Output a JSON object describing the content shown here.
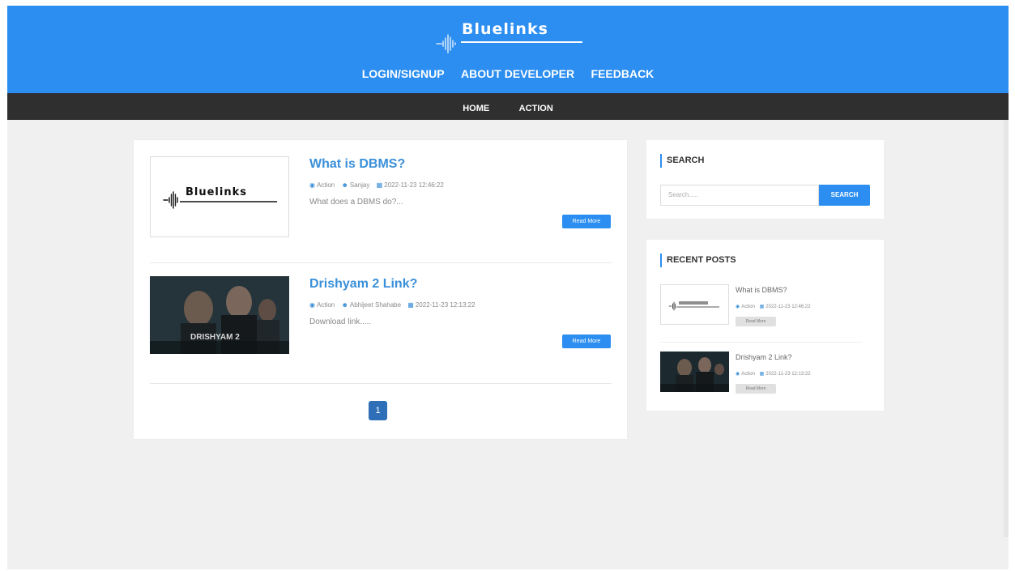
{
  "brand": {
    "name": "Bluelinks",
    "color": "#2b8ef0"
  },
  "top_nav": [
    "LOGIN/SIGNUP",
    "ABOUT DEVELOPER",
    "FEEDBACK"
  ],
  "sub_nav": [
    "HOME",
    "ACTION"
  ],
  "posts": [
    {
      "title": "What is DBMS?",
      "category": "Action",
      "author": "Sanjay",
      "date": "2022-11-23 12:46:22",
      "excerpt": "What does a DBMS do?...",
      "read_more": "Read More",
      "thumb_logo_text": "Bluelinks"
    },
    {
      "title": "Drishyam 2 Link?",
      "category": "Action",
      "author": "Abhijeet Shahabe",
      "date": "2022-11-23 12:13:22",
      "excerpt": "Download link.....",
      "read_more": "Read More",
      "thumb_poster_text": "DRISHYAM 2"
    }
  ],
  "pagination": {
    "current": "1"
  },
  "search_widget": {
    "title": "SEARCH",
    "placeholder": "Search.....",
    "button": "SEARCH"
  },
  "recent_widget": {
    "title": "RECENT POSTS",
    "items": [
      {
        "title": "What is DBMS?",
        "category": "Action",
        "date": "2022-11-23 12:46:22",
        "read_more": "Read More"
      },
      {
        "title": "Drishyam 2 Link?",
        "category": "Action",
        "date": "2022-11-23 12:13:22",
        "read_more": "Read More"
      }
    ]
  },
  "icons": {
    "category": "tag-icon",
    "author": "user-icon",
    "date": "calendar-icon"
  }
}
